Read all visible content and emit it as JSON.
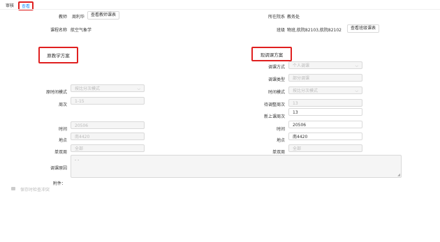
{
  "tabs": [
    "审核",
    "查看"
  ],
  "header": {
    "teacher_label": "教师",
    "teacher_value": "周利华",
    "teacher_btn": "查看教师课表",
    "dept_label": "所在院系",
    "dept_value": "教务处",
    "course_label": "课程名称",
    "course_value": "航空气象学",
    "class_label": "班级",
    "class_value": "物班,航院82103,航院82102",
    "class_btn": "查看班级课表"
  },
  "original": {
    "title": "原教学方案",
    "time_mode_label": "原时间模式",
    "time_mode_value": "按比分次模式",
    "weeks_label": "周次",
    "weeks_value": "1-15",
    "time_label": "时间",
    "time_value": "20506",
    "location_label": "地点",
    "location_value": "南4420",
    "oddeven_label": "单双周",
    "oddeven_value": "全部"
  },
  "adjusted": {
    "title": "现调课方案",
    "method_label": "调课方式",
    "method_value": "个人调课",
    "type_label": "调课类型",
    "type_value": "部分调课",
    "time_mode_label": "时间模式",
    "time_mode_value": "按比分次模式",
    "pending_weeks_label": "待调整周次",
    "pending_weeks_value": "13",
    "new_weeks_label": "新上课周次",
    "new_weeks_value": "13",
    "time_label": "时间",
    "time_value": "20506",
    "location_label": "地点",
    "location_value": "南4420",
    "oddeven_label": "单双周",
    "oddeven_value": "全部"
  },
  "reason": {
    "label": "调课原因",
    "value": "- -"
  },
  "attachment_label": "附件：",
  "save_check_label": "保存时检查冲突",
  "icons": {
    "dropdown": "chevron-down-icon",
    "resize": "resize-handle-icon",
    "checkbox": "checkbox-icon"
  },
  "colors": {
    "accent": "#1890ff",
    "highlight": "#e02020",
    "border": "#d9d9d9",
    "disabled_bg": "#f5f5f5"
  }
}
